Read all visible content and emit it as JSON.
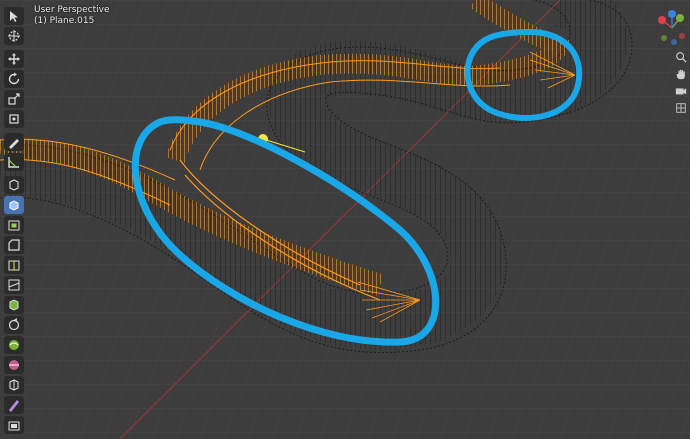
{
  "viewport": {
    "title": "User Perspective",
    "object": "(1) Plane.015"
  },
  "toolbar": {
    "tools": [
      {
        "name": "select-box",
        "icon": "cursor-select-icon",
        "active": false
      },
      {
        "name": "cursor",
        "icon": "3d-cursor-icon",
        "active": false
      },
      {
        "name": "move",
        "icon": "move-icon",
        "active": false
      },
      {
        "name": "rotate",
        "icon": "rotate-icon",
        "active": false
      },
      {
        "name": "scale",
        "icon": "scale-icon",
        "active": false
      },
      {
        "name": "transform",
        "icon": "transform-icon",
        "active": false
      },
      {
        "name": "annotate",
        "icon": "annotate-icon",
        "active": false
      },
      {
        "name": "measure",
        "icon": "measure-icon",
        "active": false
      },
      {
        "name": "add-cube",
        "icon": "add-cube-icon",
        "active": false
      },
      {
        "name": "extrude",
        "icon": "extrude-region-icon",
        "active": true
      },
      {
        "name": "inset",
        "icon": "inset-faces-icon",
        "active": false
      },
      {
        "name": "bevel",
        "icon": "bevel-icon",
        "active": false
      },
      {
        "name": "loop-cut",
        "icon": "loop-cut-icon",
        "active": false
      },
      {
        "name": "knife",
        "icon": "knife-icon",
        "active": false
      },
      {
        "name": "poly-build",
        "icon": "poly-build-icon",
        "active": false
      },
      {
        "name": "spin",
        "icon": "spin-icon",
        "active": false
      },
      {
        "name": "smooth",
        "icon": "smooth-icon",
        "active": false
      },
      {
        "name": "edge-slide",
        "icon": "edge-slide-icon",
        "active": false
      },
      {
        "name": "shrink-fatten",
        "icon": "shrink-fatten-icon",
        "active": false
      },
      {
        "name": "shear",
        "icon": "shear-icon",
        "active": false
      },
      {
        "name": "rip",
        "icon": "rip-region-icon",
        "active": false
      }
    ]
  },
  "gizmo": {
    "x_color": "#e0414d",
    "y_color": "#7bb33a",
    "z_color": "#3c82e0"
  },
  "colors": {
    "background": "#3d3d3d",
    "selected_wire": "#ff9a1f",
    "unselected_wire": "#000000",
    "annotation": "#1aa7e8",
    "light": "#f2e640",
    "x_axis": "#a4363b"
  }
}
